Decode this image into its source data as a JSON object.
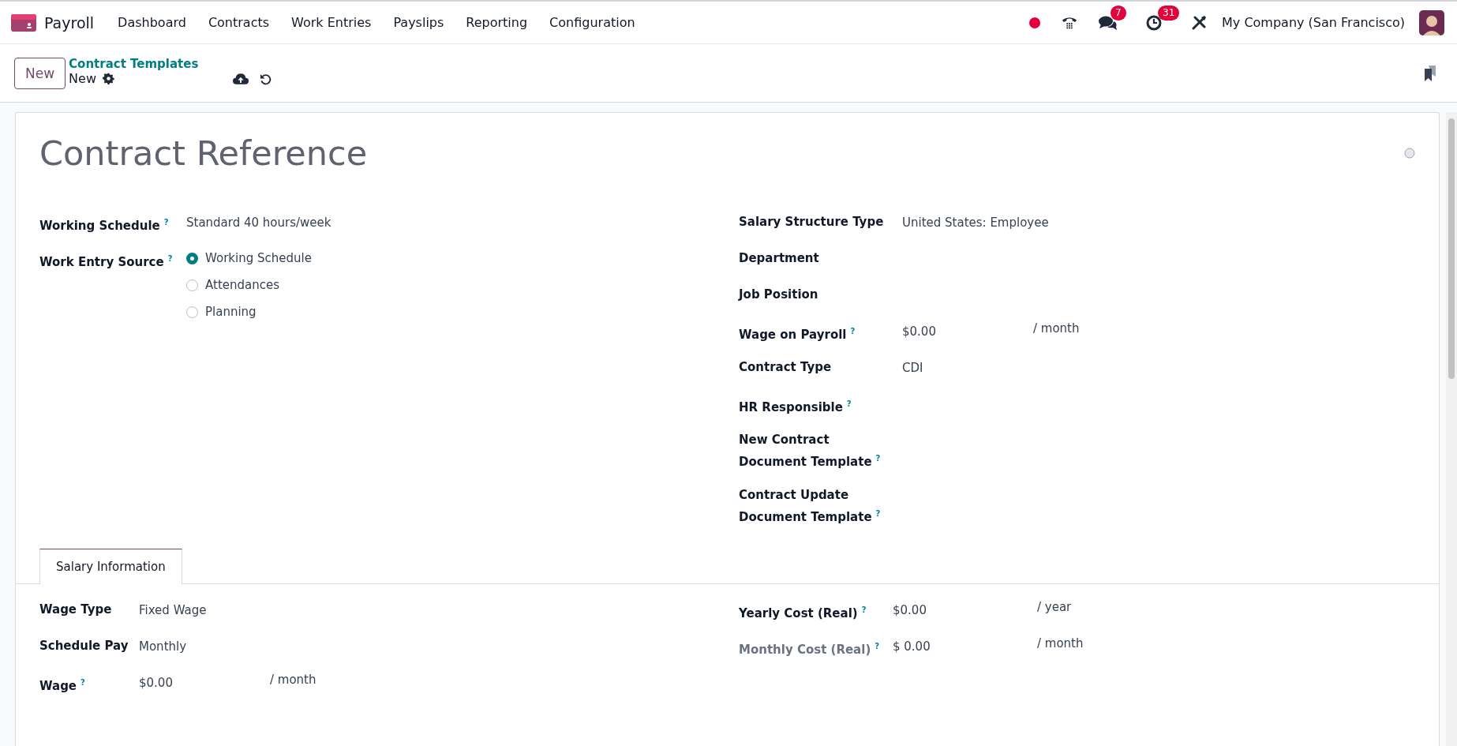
{
  "navbar": {
    "app_name": "Payroll",
    "menu": [
      "Dashboard",
      "Contracts",
      "Work Entries",
      "Payslips",
      "Reporting",
      "Configuration"
    ],
    "chat_badge": "7",
    "activity_badge": "31",
    "company": "My Company (San Francisco)"
  },
  "control_panel": {
    "new_button": "New",
    "breadcrumb": "Contract Templates",
    "current": "New"
  },
  "form": {
    "title_placeholder": "Contract Reference",
    "left_fields": [
      {
        "kind": "text",
        "label": "Working Schedule",
        "help": "?",
        "value": "Standard 40 hours/week"
      },
      {
        "kind": "radio",
        "label": "Work Entry Source",
        "help": "?",
        "options": [
          {
            "label": "Working Schedule",
            "selected": true
          },
          {
            "label": "Attendances",
            "selected": false
          },
          {
            "label": "Planning",
            "selected": false
          }
        ]
      }
    ],
    "right_fields": [
      {
        "kind": "text",
        "label": "Salary Structure Type",
        "value": "United States: Employee"
      },
      {
        "kind": "text",
        "label": "Department"
      },
      {
        "kind": "text",
        "label": "Job Position"
      },
      {
        "kind": "money",
        "label": "Wage on Payroll",
        "help": "?",
        "value": "$0.00",
        "unit": "/ month"
      },
      {
        "kind": "text",
        "label": "Contract Type",
        "value": "CDI"
      },
      {
        "kind": "text",
        "label": "HR Responsible",
        "help": "?"
      },
      {
        "kind": "text",
        "label": "New Contract Document Template",
        "help": "?"
      },
      {
        "kind": "text",
        "label": "Contract Update Document Template",
        "help": "?"
      }
    ],
    "tabs": [
      {
        "label": "Salary Information",
        "selected": true
      }
    ],
    "tab_left_fields": [
      {
        "kind": "text",
        "label": "Wage Type",
        "value": "Fixed Wage"
      },
      {
        "kind": "text",
        "label": "Schedule Pay",
        "value": "Monthly"
      },
      {
        "kind": "money",
        "label": "Wage",
        "help": "?",
        "value": "$0.00",
        "unit": "/ month"
      }
    ],
    "tab_right_fields": [
      {
        "kind": "money",
        "label": "Yearly Cost (Real)",
        "help": "?",
        "value": "$0.00",
        "unit": "/ year",
        "disabled": false
      },
      {
        "kind": "money",
        "label": "Monthly Cost (Real)",
        "help": "?",
        "value": "$ 0.00",
        "unit": "/ month",
        "disabled": true
      }
    ]
  }
}
